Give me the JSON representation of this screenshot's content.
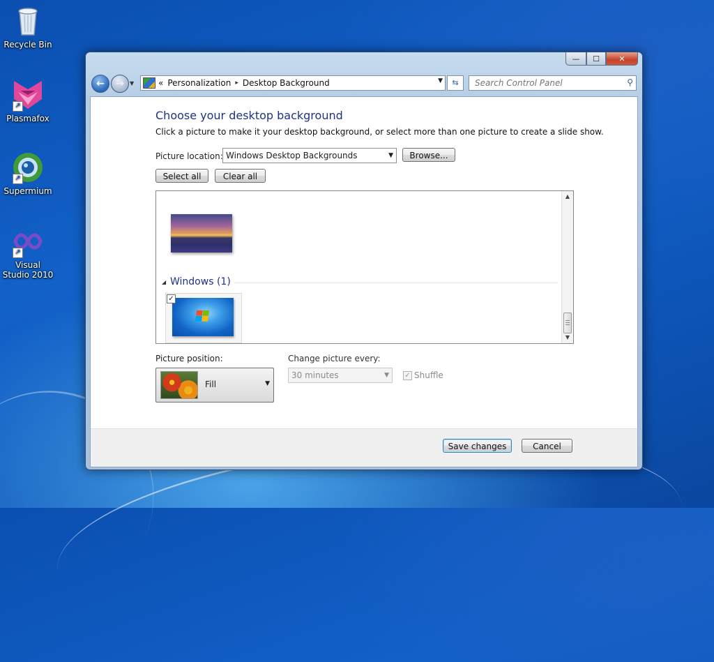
{
  "desktop": {
    "icons": [
      {
        "label": "Recycle Bin",
        "icon": "recycle-bin-icon"
      },
      {
        "label": "Plasmafox",
        "icon": "plasmafox-icon"
      },
      {
        "label": "Supermium",
        "icon": "supermium-icon"
      },
      {
        "label": "Visual Studio 2010",
        "icon": "visual-studio-icon"
      }
    ]
  },
  "window": {
    "caption_buttons": {
      "minimize": "—",
      "maximize": "☐",
      "close": "✕"
    }
  },
  "address_bar": {
    "overflow": "«",
    "crumbs": [
      "Personalization",
      "Desktop Background"
    ],
    "separator": "▸",
    "search_placeholder": "Search Control Panel"
  },
  "page": {
    "title": "Choose your desktop background",
    "description": "Click a picture to make it your desktop background, or select more than one picture to create a slide show.",
    "picture_location_label": "Picture location:",
    "picture_location_value": "Windows Desktop Backgrounds",
    "browse_label": "Browse...",
    "select_all_label": "Select all",
    "clear_all_label": "Clear all",
    "group_header": "Windows (1)",
    "picture_position_label": "Picture position:",
    "picture_position_value": "Fill",
    "change_picture_label": "Change picture every:",
    "change_picture_value": "30 minutes",
    "shuffle_label": "Shuffle",
    "save_label": "Save changes",
    "cancel_label": "Cancel"
  }
}
